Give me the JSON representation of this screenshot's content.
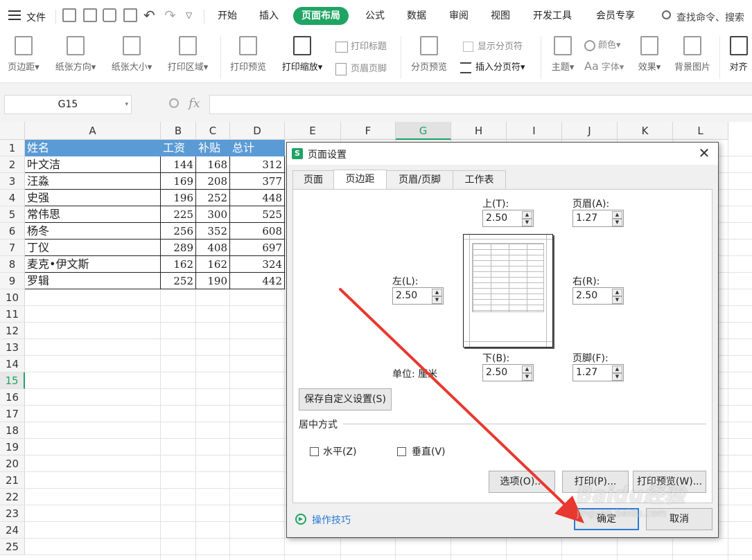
{
  "menubar": {
    "file_label": "文件",
    "tabs": [
      "开始",
      "插入",
      "页面布局",
      "公式",
      "数据",
      "审阅",
      "视图",
      "开发工具",
      "会员专享"
    ],
    "active_tab": "页面布局",
    "search_text": "查找命令、搜索"
  },
  "ribbon": {
    "margins": "页边距",
    "orientation": "纸张方向",
    "size": "纸张大小",
    "print_area": "打印区域",
    "print_preview": "打印预览",
    "print_scale": "打印缩放",
    "print_titles": "打印标题",
    "header_footer": "页眉页脚",
    "page_break_preview": "分页预览",
    "show_page_breaks": "显示分页符",
    "insert_page_break": "插入分页符",
    "theme": "主题",
    "colors": "颜色",
    "fonts": "字体",
    "effects": "效果",
    "background": "背景图片",
    "align": "对齐"
  },
  "formula_bar": {
    "name_box": "G15",
    "fx": "fx",
    "value": ""
  },
  "sheet": {
    "columns": [
      "A",
      "B",
      "C",
      "D",
      "E",
      "F",
      "G",
      "H",
      "I",
      "J",
      "K",
      "L"
    ],
    "rows": [
      "1",
      "2",
      "3",
      "4",
      "5",
      "6",
      "7",
      "8",
      "9",
      "10",
      "11",
      "12",
      "13",
      "14",
      "15",
      "16",
      "17",
      "18",
      "19",
      "20",
      "21",
      "22",
      "23",
      "24",
      "25"
    ],
    "selected_column": "G",
    "selected_row": "15",
    "headers": [
      "姓名",
      "工资",
      "补贴",
      "总计"
    ],
    "data": [
      [
        "叶文洁",
        "144",
        "168",
        "312"
      ],
      [
        "汪淼",
        "169",
        "208",
        "377"
      ],
      [
        "史强",
        "196",
        "252",
        "448"
      ],
      [
        "常伟思",
        "225",
        "300",
        "525"
      ],
      [
        "杨冬",
        "256",
        "352",
        "608"
      ],
      [
        "丁仪",
        "289",
        "408",
        "697"
      ],
      [
        "麦克•伊文斯",
        "162",
        "162",
        "324"
      ],
      [
        "罗辑",
        "252",
        "190",
        "442"
      ]
    ],
    "header_fill": "#5b9bd5"
  },
  "dialog": {
    "title": "页面设置",
    "tabs": [
      "页面",
      "页边距",
      "页眉/页脚",
      "工作表"
    ],
    "active_tab": "页边距",
    "top_label": "上(T):",
    "top_value": "2.50",
    "header_label": "页眉(A):",
    "header_value": "1.27",
    "left_label": "左(L):",
    "left_value": "2.50",
    "right_label": "右(R):",
    "right_value": "2.50",
    "bottom_label": "下(B):",
    "bottom_value": "2.50",
    "footer_label": "页脚(F):",
    "footer_value": "1.27",
    "unit_label": "单位: 厘米",
    "save_custom": "保存自定义设置(S)",
    "center_group": "居中方式",
    "horizontal": "水平(Z)",
    "vertical": "垂直(V)",
    "options_button": "选项(O)...",
    "print_button": "打印(P)...",
    "preview_button": "打印预览(W)...",
    "tips_link": "操作技巧",
    "ok_button": "确定",
    "cancel_button": "取消"
  },
  "watermark": {
    "brand": "Baidu经验",
    "url": "jingyan.baidu.com"
  },
  "colors": {
    "accent": "#1fa463",
    "arrow": "#e8382f"
  }
}
